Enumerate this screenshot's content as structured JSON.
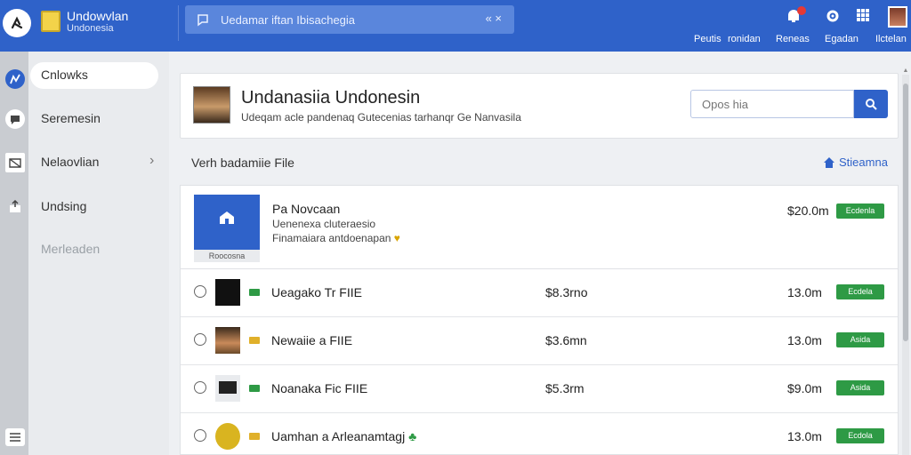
{
  "app": {
    "title": "Undowvlan",
    "subtitle": "Undonesia"
  },
  "top_search": {
    "placeholder": "Uedamar iftan Ibisachegia"
  },
  "top_actions": [
    {
      "label": "Peutis",
      "icon": "bell-icon"
    },
    {
      "label": "ronidan",
      "icon": ""
    },
    {
      "label": "Reneas",
      "icon": ""
    },
    {
      "label": "Egadan",
      "icon": "gear-icon"
    },
    {
      "label": "Ilctelan",
      "icon": "avatar"
    }
  ],
  "sidebar": {
    "items": [
      {
        "label": "Cnlowks",
        "icon": "dashboard-icon",
        "active": true
      },
      {
        "label": "Seremesin",
        "icon": "chat-icon"
      },
      {
        "label": "Nelaovlian",
        "icon": "map-icon",
        "has_chevron": true
      },
      {
        "label": "Undsing",
        "icon": "upload-icon"
      },
      {
        "label": "Merleaden",
        "icon": "",
        "disabled": true
      }
    ]
  },
  "header": {
    "title": "Undanasiia Undonesin",
    "subtitle": "Udeqam acle pandenaq Gutecenias tarhanqr Ge Nanvasila",
    "search_placeholder": "Opos hia"
  },
  "section": {
    "title": "Verh badamiie File",
    "link_label": "Stieamna"
  },
  "featured": {
    "image_caption": "Roocosna",
    "title": "Pa Novcaan",
    "line1": "Uenenexa cluteraesio",
    "line2": "Finamaiara antdoenapan",
    "price": "$20.0m",
    "badge": "Ecdenla"
  },
  "rows": [
    {
      "name": "Ueagako Tr FIIE",
      "price1": "$8.3rno",
      "price2": "13.0m",
      "badge": "Ecdela",
      "thumb": "#111111",
      "tag": "#2e9a45"
    },
    {
      "name": "Newaiie a FIIE",
      "price1": "$3.6mn",
      "price2": "13.0m",
      "badge": "Asida",
      "thumb": "#c98a5a",
      "tag": "#e0b02a"
    },
    {
      "name": "Noanaka Fic FIIE",
      "price1": "$5.3rm",
      "price2": "$9.0m",
      "badge": "Asida",
      "thumb": "#222222",
      "tag": "#2e9a45"
    },
    {
      "name": "Uamhan a Arleanamtagj",
      "price1": "",
      "price2": "13.0m",
      "badge": "Ecdola",
      "thumb": "#d9b420",
      "tag": "#e0b02a"
    }
  ],
  "colors": {
    "brand": "#2f62c9",
    "success": "#2e9a45"
  }
}
